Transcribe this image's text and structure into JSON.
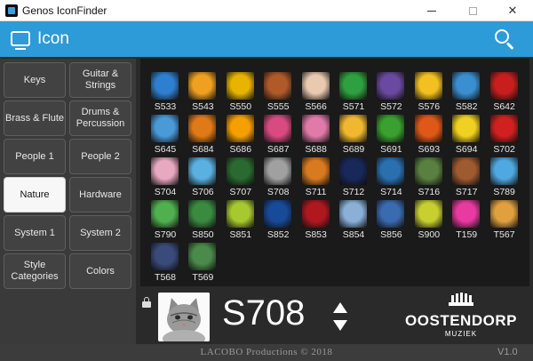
{
  "window": {
    "title": "Genos IconFinder",
    "min_glyph": "—",
    "close_glyph": "✕"
  },
  "header": {
    "title": "Icon",
    "accent": "#2d9bd7"
  },
  "categories": [
    {
      "label": "Keys",
      "selected": false
    },
    {
      "label": "Guitar & Strings",
      "selected": false
    },
    {
      "label": "Brass & Flute",
      "selected": false
    },
    {
      "label": "Drums & Percussion",
      "selected": false
    },
    {
      "label": "People 1",
      "selected": false
    },
    {
      "label": "People 2",
      "selected": false
    },
    {
      "label": "Nature",
      "selected": true
    },
    {
      "label": "Hardware",
      "selected": false
    },
    {
      "label": "System 1",
      "selected": false
    },
    {
      "label": "System 2",
      "selected": false
    },
    {
      "label": "Style Categories",
      "selected": false
    },
    {
      "label": "Colors",
      "selected": false
    }
  ],
  "icons": [
    {
      "code": "S533",
      "color": "#2f7fcf"
    },
    {
      "code": "S543",
      "color": "#f0a020"
    },
    {
      "code": "S550",
      "color": "#e8b400"
    },
    {
      "code": "S555",
      "color": "#b05a2a"
    },
    {
      "code": "S566",
      "color": "#e9c9b0"
    },
    {
      "code": "S571",
      "color": "#2fa040"
    },
    {
      "code": "S572",
      "color": "#6a4aa0"
    },
    {
      "code": "S576",
      "color": "#f2c020"
    },
    {
      "code": "S582",
      "color": "#3a8fd0"
    },
    {
      "code": "S642",
      "color": "#c81e1e"
    },
    {
      "code": "S645",
      "color": "#4a9ad8"
    },
    {
      "code": "S684",
      "color": "#e07a18"
    },
    {
      "code": "S686",
      "color": "#f5a000"
    },
    {
      "code": "S687",
      "color": "#d84a80"
    },
    {
      "code": "S688",
      "color": "#e07aa8"
    },
    {
      "code": "S689",
      "color": "#f0b830"
    },
    {
      "code": "S691",
      "color": "#3aa030"
    },
    {
      "code": "S693",
      "color": "#e05818"
    },
    {
      "code": "S694",
      "color": "#f0d020"
    },
    {
      "code": "S702",
      "color": "#d02020"
    },
    {
      "code": "S704",
      "color": "#e8a8c0"
    },
    {
      "code": "S706",
      "color": "#5ab0e0"
    },
    {
      "code": "S707",
      "color": "#2a6a30"
    },
    {
      "code": "S708",
      "color": "#a0a0a0"
    },
    {
      "code": "S711",
      "color": "#d87a20"
    },
    {
      "code": "S712",
      "color": "#18285a"
    },
    {
      "code": "S714",
      "color": "#2a70b0"
    },
    {
      "code": "S716",
      "color": "#5a8040"
    },
    {
      "code": "S717",
      "color": "#a05a30"
    },
    {
      "code": "S789",
      "color": "#50a8e0"
    },
    {
      "code": "S790",
      "color": "#50b050"
    },
    {
      "code": "S850",
      "color": "#3a8a40"
    },
    {
      "code": "S851",
      "color": "#a8c830"
    },
    {
      "code": "S852",
      "color": "#184a9a"
    },
    {
      "code": "S853",
      "color": "#b01820"
    },
    {
      "code": "S854",
      "color": "#8ab0d8"
    },
    {
      "code": "S856",
      "color": "#3a6ab0"
    },
    {
      "code": "S900",
      "color": "#c8d030"
    },
    {
      "code": "T159",
      "color": "#e83aa0"
    },
    {
      "code": "T567",
      "color": "#e0a040"
    },
    {
      "code": "T568",
      "color": "#3a4a7a"
    },
    {
      "code": "T569",
      "color": "#4a8a4a"
    }
  ],
  "preview": {
    "code": "S708",
    "icon": "cat-photo"
  },
  "logo": {
    "brand": "OOSTENDORP",
    "sub": "MUZIEK"
  },
  "footer": {
    "credit": "LACOBO Productions © 2018",
    "version": "V1.0"
  }
}
